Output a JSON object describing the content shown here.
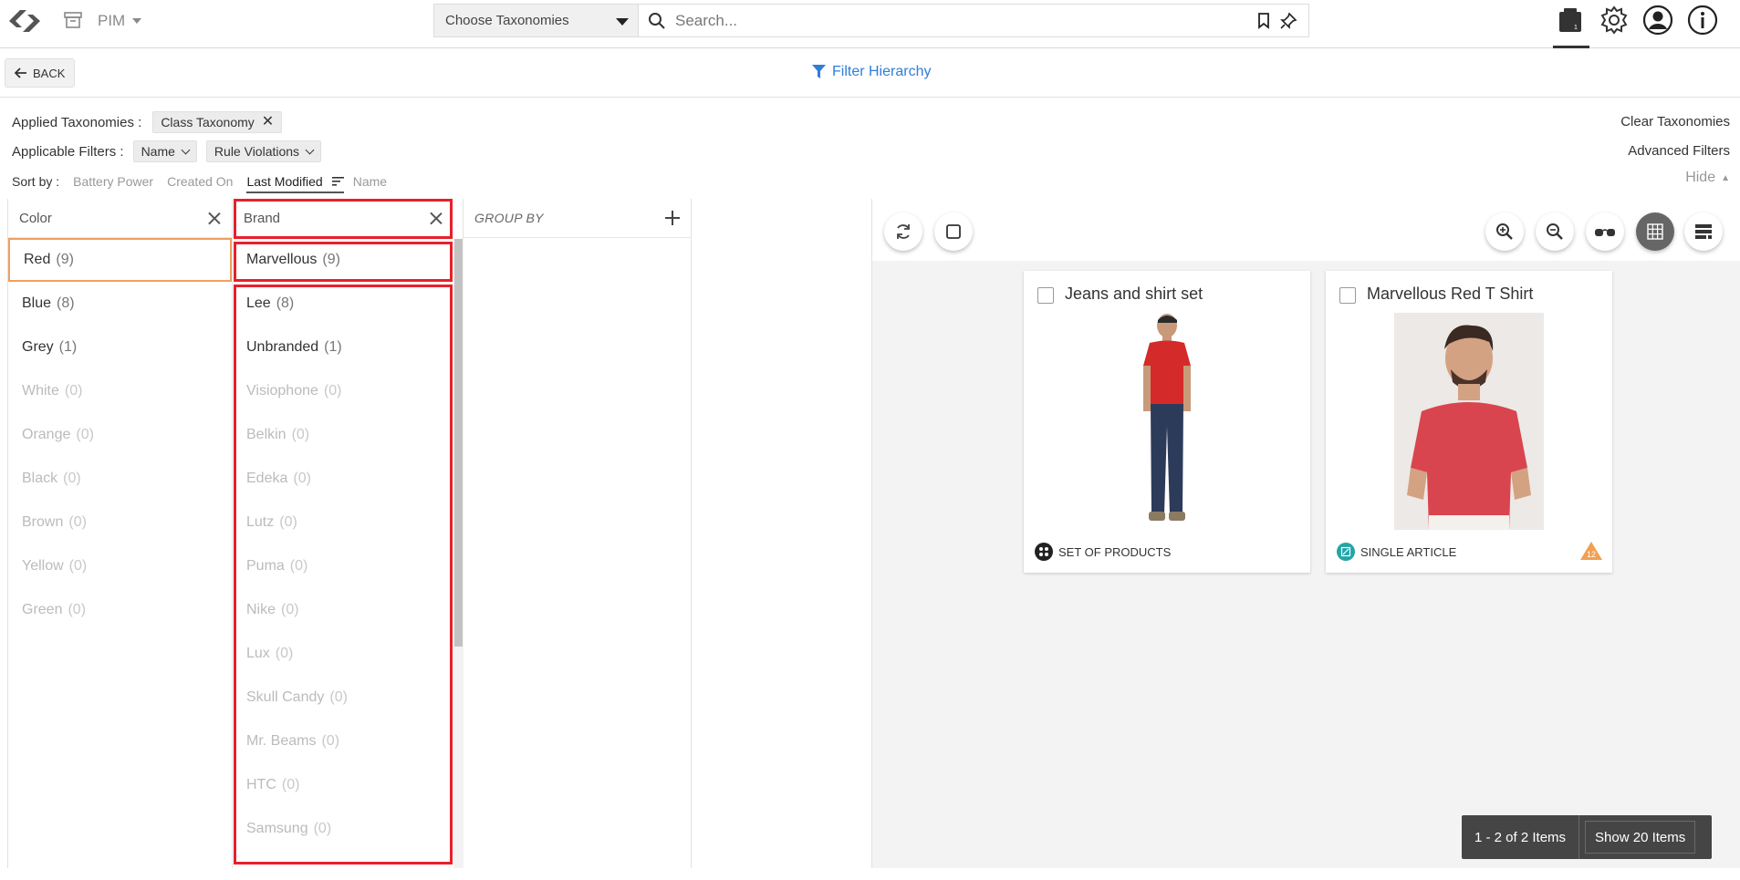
{
  "header": {
    "app_name": "PIM",
    "taxonomy_select": "Choose Taxonomies",
    "search_placeholder": "Search...",
    "icons": [
      "logo-icon",
      "archive-icon",
      "search-icon",
      "bookmark-icon",
      "pin-icon",
      "widget-icon",
      "settings-icon",
      "user-icon",
      "info-icon"
    ]
  },
  "subbar": {
    "back_label": "BACK",
    "filter_hierarchy_label": "Filter Hierarchy"
  },
  "filters": {
    "applied_taxonomies_label": "Applied Taxonomies :",
    "applied_taxonomies": [
      "Class Taxonomy"
    ],
    "applicable_filters_label": "Applicable Filters :",
    "applicable_filters": [
      "Name",
      "Rule Violations"
    ],
    "sort_label": "Sort by :",
    "sort_options": [
      "Battery Power",
      "Created On",
      "Last Modified",
      "Name"
    ],
    "sort_active": "Last Modified",
    "clear_taxonomies": "Clear Taxonomies",
    "advanced_filters": "Advanced Filters",
    "hide_label": "Hide"
  },
  "color_panel": {
    "title": "Color",
    "items": [
      {
        "label": "Red",
        "count": "(9)"
      },
      {
        "label": "Blue",
        "count": "(8)"
      },
      {
        "label": "Grey",
        "count": "(1)"
      },
      {
        "label": "White",
        "count": "(0)"
      },
      {
        "label": "Orange",
        "count": "(0)"
      },
      {
        "label": "Black",
        "count": "(0)"
      },
      {
        "label": "Brown",
        "count": "(0)"
      },
      {
        "label": "Yellow",
        "count": "(0)"
      },
      {
        "label": "Green",
        "count": "(0)"
      }
    ]
  },
  "brand_panel": {
    "title": "Brand",
    "items": [
      {
        "label": "Marvellous",
        "count": "(9)"
      },
      {
        "label": "Lee",
        "count": "(8)"
      },
      {
        "label": "Unbranded",
        "count": "(1)"
      },
      {
        "label": "Visiophone",
        "count": "(0)"
      },
      {
        "label": "Belkin",
        "count": "(0)"
      },
      {
        "label": "Edeka",
        "count": "(0)"
      },
      {
        "label": "Lutz",
        "count": "(0)"
      },
      {
        "label": "Puma",
        "count": "(0)"
      },
      {
        "label": "Nike",
        "count": "(0)"
      },
      {
        "label": "Lux",
        "count": "(0)"
      },
      {
        "label": "Skull Candy",
        "count": "(0)"
      },
      {
        "label": "Mr. Beams",
        "count": "(0)"
      },
      {
        "label": "HTC",
        "count": "(0)"
      },
      {
        "label": "Samsung",
        "count": "(0)"
      }
    ]
  },
  "groupby_panel": {
    "title": "GROUP BY"
  },
  "results": {
    "cards": [
      {
        "title": "Jeans and shirt set",
        "type": "SET OF PRODUCTS"
      },
      {
        "title": "Marvellous Red T Shirt",
        "type": "SINGLE ARTICLE",
        "badge": "12"
      }
    ],
    "pager_count": "1 - 2 of 2 Items",
    "pager_show": "Show 20 Items"
  },
  "colors": {
    "accent_blue": "#2f7ed8",
    "highlight_red": "#e8202a",
    "selected_orange": "#f0a060"
  }
}
